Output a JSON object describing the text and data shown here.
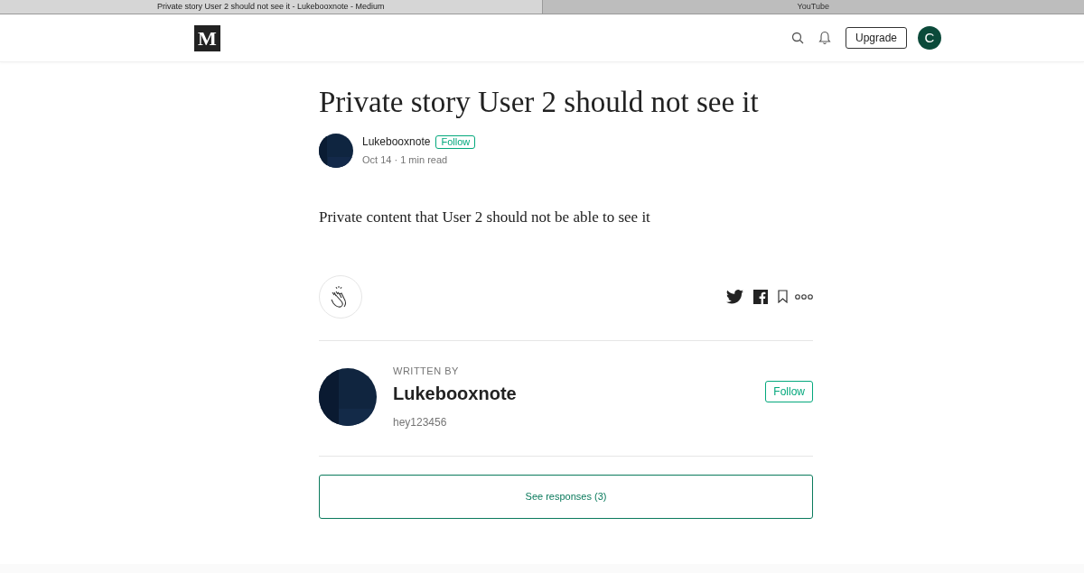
{
  "browser_tabs": [
    {
      "label": "Private story User 2 should not see it - Lukebooxnote - Medium",
      "selected": true
    },
    {
      "label": "YouTube",
      "selected": false
    }
  ],
  "header": {
    "logo": "M",
    "upgrade_button": "Upgrade",
    "user_initial": "C"
  },
  "article": {
    "title": "Private story User 2 should not see it",
    "author": "Lukebooxnote",
    "follow_button": "Follow",
    "meta": "Oct 14 · 1 min read",
    "body": "Private content that User 2 should not be able to see it"
  },
  "author_card": {
    "label": "WRITTEN BY",
    "name": "Lukebooxnote",
    "bio": "hey123456",
    "follow_button": "Follow"
  },
  "responses_button": "See responses (3)"
}
